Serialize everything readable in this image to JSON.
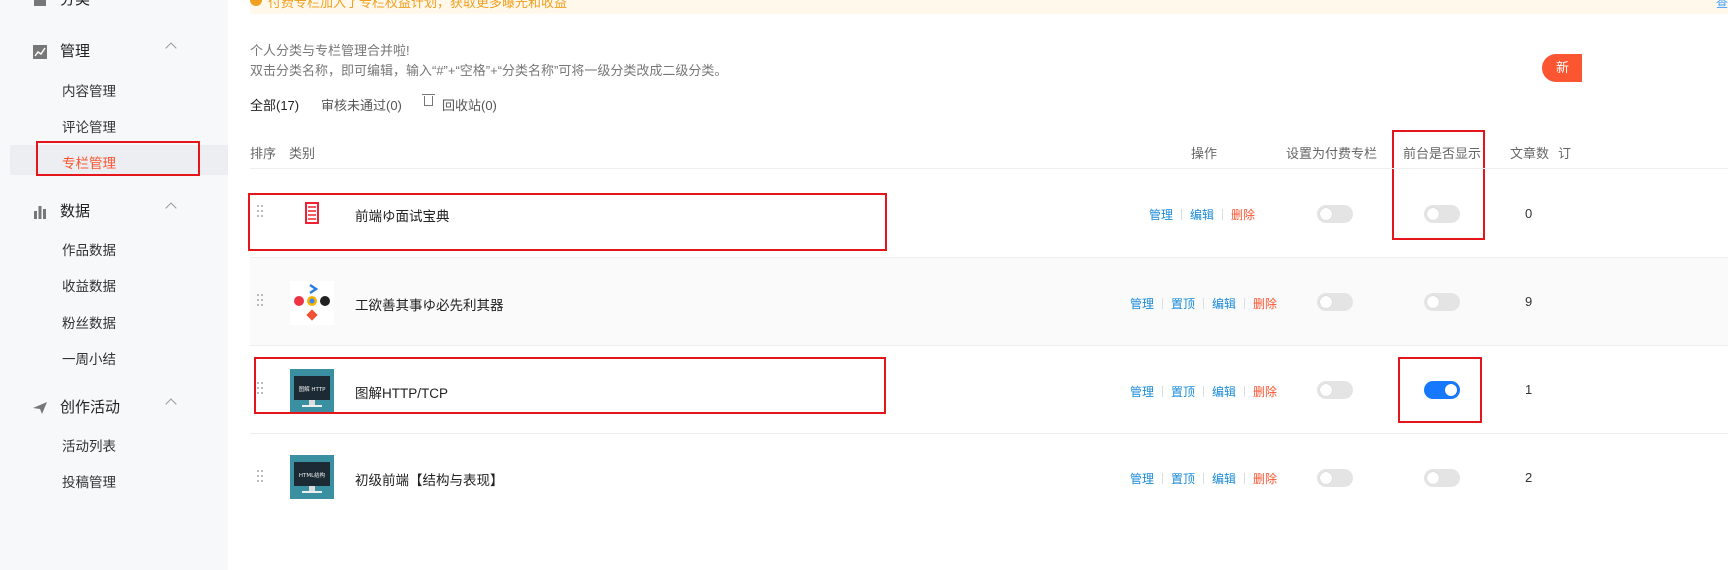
{
  "sidebar": {
    "top_label": "分类",
    "groups": [
      {
        "label": "管理",
        "icon": "chart-icon",
        "items": [
          "内容管理",
          "评论管理",
          "专栏管理"
        ]
      },
      {
        "label": "数据",
        "icon": "bar-chart-icon",
        "items": [
          "作品数据",
          "收益数据",
          "粉丝数据",
          "一周小结"
        ]
      },
      {
        "label": "创作活动",
        "icon": "send-icon",
        "items": [
          "活动列表",
          "投稿管理"
        ]
      }
    ],
    "active_item": "专栏管理"
  },
  "banner": {
    "text": "付费专栏加入了专栏权益计划，获取更多曝光和收益",
    "right": "查"
  },
  "hints": [
    "个人分类与专栏管理合并啦!",
    "双击分类名称，即可编辑，输入“#”+“空格”+“分类名称”可将一级分类改成二级分类。"
  ],
  "new_button": "新",
  "tabs": [
    "全部(17)",
    "审核未通过(0)",
    "回收站(0)"
  ],
  "headers": {
    "sort": "排序",
    "category": "类别",
    "ops": "操作",
    "paid": "设置为付费专栏",
    "visible": "前台是否显示",
    "count": "文章数",
    "extra": "订"
  },
  "rows": [
    {
      "name": "前端ゆ面试宝典",
      "ops": [
        "管理",
        "编辑",
        "删除"
      ],
      "paid": false,
      "visible": false,
      "count": "0",
      "thumb": "scroll-icon"
    },
    {
      "name": "工欲善其事ゆ必先利其器",
      "ops": [
        "管理",
        "置顶",
        "编辑",
        "删除"
      ],
      "paid": false,
      "visible": false,
      "count": "9",
      "thumb": "tools-icon"
    },
    {
      "name": "图解HTTP/TCP",
      "ops": [
        "管理",
        "置顶",
        "编辑",
        "删除"
      ],
      "paid": false,
      "visible": true,
      "count": "1",
      "thumb": "monitor-icon",
      "monitor_text": "图解 HTTP"
    },
    {
      "name": "初级前端【结构与表现】",
      "ops": [
        "管理",
        "置顶",
        "编辑",
        "删除"
      ],
      "paid": false,
      "visible": false,
      "count": "2",
      "thumb": "monitor-icon",
      "monitor_text": "HTML结构"
    }
  ]
}
